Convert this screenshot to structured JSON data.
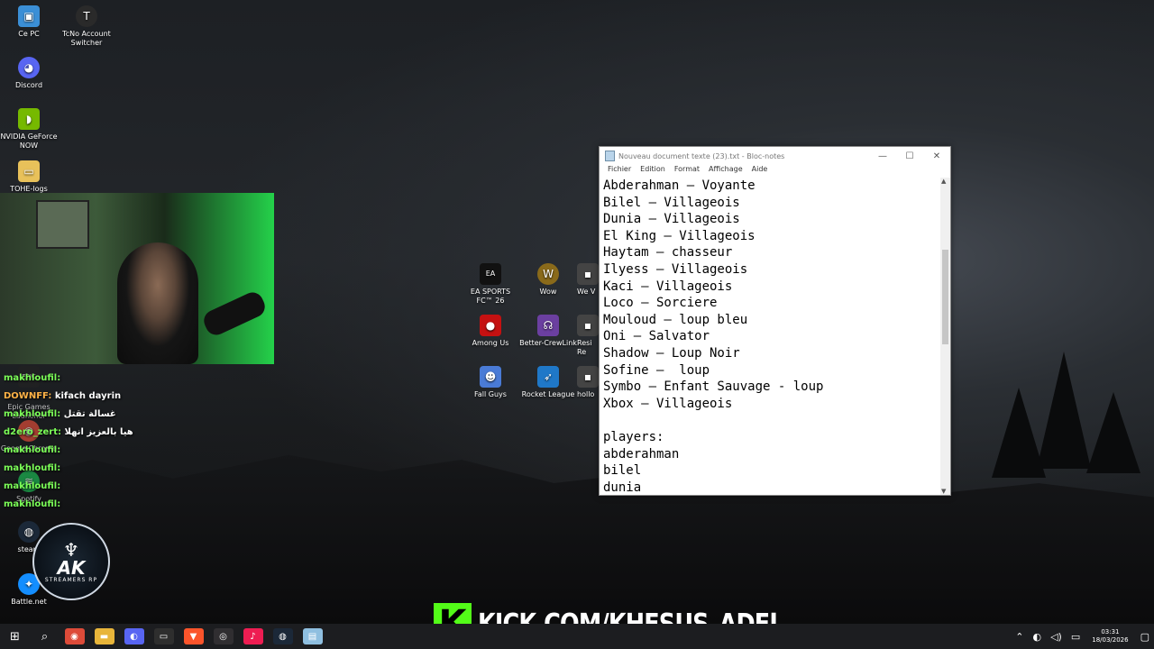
{
  "desktop": {
    "icons_left": [
      {
        "label": "Ce PC",
        "icon": "computer-icon",
        "color": "#3b8fd6"
      },
      {
        "label": "TcNo Account Switcher",
        "icon": "tcno-icon",
        "color": "#2a2a2a"
      },
      {
        "label": "Discord",
        "icon": "discord-icon",
        "color": "#5865f2"
      },
      {
        "label": "NVIDIA GeForce NOW",
        "icon": "nvidia-icon",
        "color": "#76b900"
      },
      {
        "label": "TOHE-logs",
        "icon": "folder-icon",
        "color": "#e8c15a"
      },
      {
        "label": "Epic Games Launcher",
        "icon": "epic-icon",
        "color": "#222"
      },
      {
        "label": "Google Chrome",
        "icon": "chrome-icon",
        "color": "#dd4b39"
      },
      {
        "label": "Spotify",
        "icon": "spotify-icon",
        "color": "#1db954"
      },
      {
        "label": "steam",
        "icon": "steam-icon",
        "color": "#1b2838"
      },
      {
        "label": "Battle.net",
        "icon": "battlenet-icon",
        "color": "#148eff"
      }
    ],
    "icons_center": [
      {
        "label": "EA SPORTS FC™ 26",
        "icon": "ea-icon",
        "color": "#111"
      },
      {
        "label": "Wow",
        "icon": "wow-icon",
        "color": "#8a6a1a"
      },
      {
        "label": "We V",
        "icon": "game-icon",
        "color": "#444"
      },
      {
        "label": "Among Us",
        "icon": "among-us-icon",
        "color": "#c51111"
      },
      {
        "label": "Better-CrewLink",
        "icon": "crewlink-icon",
        "color": "#6b3fa0"
      },
      {
        "label": "Resi Re",
        "icon": "game-icon",
        "color": "#444"
      },
      {
        "label": "Fall Guys",
        "icon": "fall-guys-icon",
        "color": "#4a7bd6"
      },
      {
        "label": "Rocket League",
        "icon": "rocket-league-icon",
        "color": "#1f78c8"
      },
      {
        "label": "hollo",
        "icon": "game-icon",
        "color": "#444"
      }
    ]
  },
  "chat": [
    {
      "user": "makhloufil:",
      "msg": "",
      "style": "user"
    },
    {
      "user": "DOWNFF:",
      "msg": "kifach dayrin",
      "style": "user2"
    },
    {
      "user": "makhloufil:",
      "msg": "غسالة تقتل",
      "style": "user"
    },
    {
      "user": "d2ero_zert:",
      "msg": "هيا بالعزيز انهلا",
      "style": "user"
    },
    {
      "user": "makhloufil:",
      "msg": "",
      "style": "user"
    },
    {
      "user": "makhloufil:",
      "msg": "",
      "style": "user"
    },
    {
      "user": "makhloufil:",
      "msg": "",
      "style": "user"
    },
    {
      "user": "makhloufil:",
      "msg": "",
      "style": "user"
    }
  ],
  "logo": {
    "wing": "♆",
    "ak": "AK",
    "sub": "STREAMERS RP"
  },
  "notepad": {
    "title": "Nouveau document texte (23).txt - Bloc-notes",
    "menu": [
      "Fichier",
      "Edition",
      "Format",
      "Affichage",
      "Aide"
    ],
    "lines": [
      "Abderahman — Voyante",
      "Bilel — Villageois",
      "Dunia — Villageois",
      "El King — Villageois",
      "Haytam — chasseur",
      "Ilyess — Villageois",
      "Kaci — Villageois",
      "Loco — Sorciere",
      "Mouloud — loup bleu",
      "Oni — Salvator",
      "Shadow — Loup Noir",
      "Sofine —  loup",
      "Symbo — Enfant Sauvage - loup",
      "Xbox — Villageois",
      "",
      "players:",
      "abderahman",
      "bilel",
      "dunia"
    ],
    "controls": {
      "minimize": "—",
      "maximize": "☐",
      "close": "✕"
    }
  },
  "overlay": {
    "kick_letter": "K",
    "url": "KICK.COM/KHESUS_ADEL",
    "accent": "#53fc18"
  },
  "taskbar": {
    "apps": [
      {
        "icon": "chrome-icon",
        "color": "#dd4b39",
        "glyph": "◉"
      },
      {
        "icon": "file-explorer-icon",
        "color": "#e8b53a",
        "glyph": "▬"
      },
      {
        "icon": "discord-icon",
        "color": "#5865f2",
        "glyph": "◐"
      },
      {
        "icon": "terminal-icon",
        "color": "#2e2e2e",
        "glyph": "▭"
      },
      {
        "icon": "brave-icon",
        "color": "#fb542b",
        "glyph": "▼"
      },
      {
        "icon": "obs-icon",
        "color": "#302e31",
        "glyph": "◎"
      },
      {
        "icon": "tiktok-icon",
        "color": "#ee1d52",
        "glyph": "♪"
      },
      {
        "icon": "steam-icon",
        "color": "#1b2838",
        "glyph": "◍"
      },
      {
        "icon": "notepad-icon",
        "color": "#8fbfe0",
        "glyph": "▤"
      }
    ],
    "time": "03:31",
    "date": "18/03/2026"
  }
}
